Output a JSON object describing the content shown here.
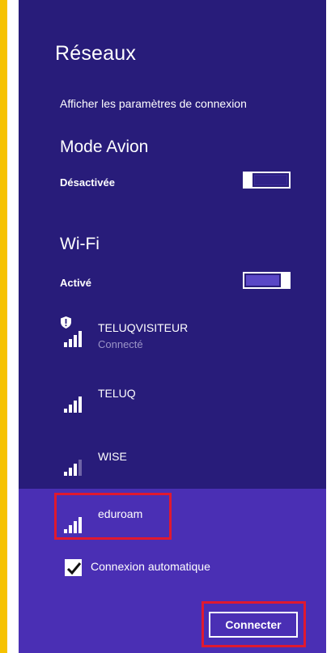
{
  "panel": {
    "title": "Réseaux",
    "settings_link": "Afficher les paramètres de connexion"
  },
  "airplane_mode": {
    "title": "Mode Avion",
    "state_label": "Désactivée",
    "enabled": false
  },
  "wifi": {
    "title": "Wi-Fi",
    "state_label": "Activé",
    "enabled": true
  },
  "networks": [
    {
      "name": "TELUQVISITEUR",
      "status": "Connecté",
      "secured_icon": "shield-icon",
      "signal_bars": 4
    },
    {
      "name": "TELUQ",
      "status": "",
      "signal_bars": 4
    },
    {
      "name": "WISE",
      "status": "",
      "signal_bars": 3
    },
    {
      "name": "eduroam",
      "status": "",
      "signal_bars": 4,
      "selected": true
    }
  ],
  "auto_connect": {
    "label": "Connexion automatique",
    "checked": true
  },
  "connect_button": {
    "label": "Connecter"
  },
  "colors": {
    "panel_bg": "#281c7a",
    "selected_bg": "#4a2fb4",
    "accent_strip": "#f6c200",
    "highlight_border": "#e0192f"
  }
}
